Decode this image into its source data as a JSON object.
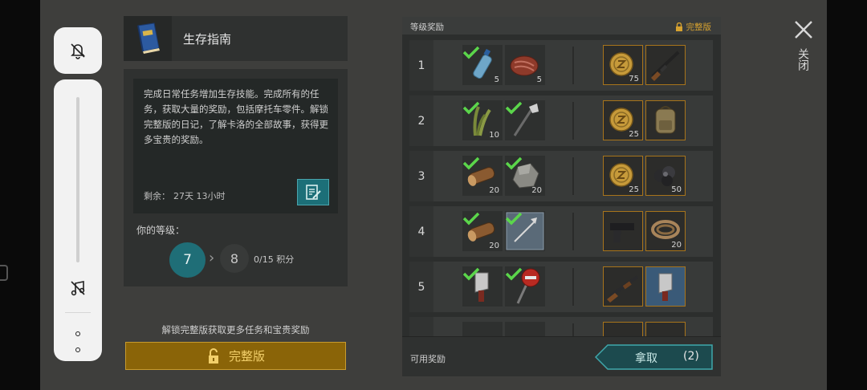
{
  "guide": {
    "title": "生存指南",
    "description": "完成日常任务增加生存技能。完成所有的任务，获取大量的奖励，包括摩托车零件。解锁完整版的日记，了解卡洛的全部故事，获得更多宝贵的奖励。",
    "remaining_label": "剩余：",
    "remaining_value": "27天 13小时",
    "level_label": "你的等级：",
    "current_level": "7",
    "next_level": "8",
    "points": "0/15 积分",
    "unlock_hint": "解锁完整版获取更多任务和宝贵奖励",
    "unlock_button": "完整版"
  },
  "rewards": {
    "title": "等级奖励",
    "premium_label": "完整版",
    "available_label": "可用奖励",
    "claim_label": "拿取",
    "claim_count": "(2)",
    "rows": [
      {
        "level": "1",
        "free": [
          {
            "item": "water-bottle",
            "qty": "5"
          },
          {
            "item": "raw-meat",
            "qty": "5"
          }
        ],
        "premium": [
          {
            "item": "coin",
            "qty": "75"
          },
          {
            "item": "rifle",
            "qty": ""
          }
        ]
      },
      {
        "level": "2",
        "free": [
          {
            "item": "plant-fiber",
            "qty": "10"
          },
          {
            "item": "hatchet",
            "qty": ""
          }
        ],
        "premium": [
          {
            "item": "coin",
            "qty": "25"
          },
          {
            "item": "backpack",
            "qty": ""
          }
        ]
      },
      {
        "level": "3",
        "free": [
          {
            "item": "wood-log",
            "qty": "20"
          },
          {
            "item": "stone",
            "qty": "20"
          }
        ],
        "premium": [
          {
            "item": "coin",
            "qty": "25"
          },
          {
            "item": "coal-ore",
            "qty": "50"
          }
        ]
      },
      {
        "level": "4",
        "free": [
          {
            "item": "wood-log",
            "qty": "20"
          },
          {
            "item": "blueprint",
            "qty": ""
          }
        ],
        "premium": [
          {
            "item": "pistol",
            "qty": ""
          },
          {
            "item": "rope",
            "qty": "20"
          }
        ]
      },
      {
        "level": "5",
        "free": [
          {
            "item": "cleaver",
            "qty": ""
          },
          {
            "item": "stop-sign",
            "qty": ""
          }
        ],
        "premium": [
          {
            "item": "shotgun",
            "qty": ""
          },
          {
            "item": "cleaver-blueprint",
            "qty": ""
          }
        ]
      }
    ]
  },
  "close_label": "关闭",
  "colors": {
    "accent_teal": "#1f6e77",
    "premium_gold": "#d6a230",
    "check_green": "#5bd64b"
  }
}
